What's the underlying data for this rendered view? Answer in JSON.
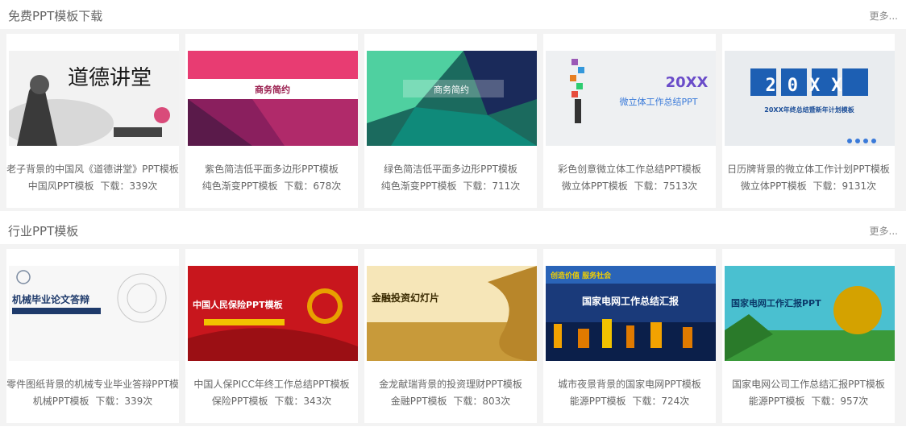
{
  "sections": [
    {
      "title": "免费PPT模板下载",
      "more": "更多...",
      "cards": [
        {
          "title": "老子背景的中国风《道德讲堂》PPT模板",
          "category": "中国风PPT模板",
          "downloads": "下载：339次",
          "thumb_text": "道德讲堂"
        },
        {
          "title": "紫色简洁低平面多边形PPT模板",
          "category": "纯色渐变PPT模板",
          "downloads": "下载：678次",
          "thumb_text": "商务简约",
          "thumb_sub": "BUSINESS SIMPLE LOW POLY NEW PPT"
        },
        {
          "title": "绿色简洁低平面多边形PPT模板",
          "category": "纯色渐变PPT模板",
          "downloads": "下载：711次",
          "thumb_text": "商务简约",
          "thumb_sub": "BUSINESS SIMPLE LOW POLY NEW PPT"
        },
        {
          "title": "彩色创意微立体工作总结PPT模板",
          "category": "微立体PPT模板",
          "downloads": "下载：7513次",
          "thumb_text": "微立体工作总结PPT",
          "thumb_year": "20XX"
        },
        {
          "title": "日历牌背景的微立体工作计划PPT模板",
          "category": "微立体PPT模板",
          "downloads": "下载：9131次",
          "thumb_text": "20XX年终总结暨新年计划模板",
          "thumb_year": "20XX"
        }
      ]
    },
    {
      "title": "行业PPT模板",
      "more": "更多...",
      "cards": [
        {
          "title": "零件图纸背景的机械专业毕业答辩PPT模",
          "category": "机械PPT模板",
          "downloads": "下载：339次",
          "thumb_text": "机械毕业论文答辩",
          "thumb_sub": "THE BUSENESS PLAN"
        },
        {
          "title": "中国人保PICC年终工作总结PPT模板",
          "category": "保险PPT模板",
          "downloads": "下载：343次",
          "thumb_text": "中国人民保险PPT模板",
          "thumb_sub": "20XX POWERPOINT"
        },
        {
          "title": "金龙献瑞背景的投资理财PPT模板",
          "category": "金融PPT模板",
          "downloads": "下载：803次",
          "thumb_text": "金融投资幻灯片",
          "thumb_sub": "THE BUSENESS PLAN"
        },
        {
          "title": "城市夜景背景的国家电网PPT模板",
          "category": "能源PPT模板",
          "downloads": "下载：724次",
          "thumb_text": "国家电网工作总结汇报",
          "thumb_sub": "创造价值 服务社会"
        },
        {
          "title": "国家电网公司工作总结汇报PPT模板",
          "category": "能源PPT模板",
          "downloads": "下载：957次",
          "thumb_text": "国家电网工作汇报PPT"
        }
      ]
    }
  ]
}
